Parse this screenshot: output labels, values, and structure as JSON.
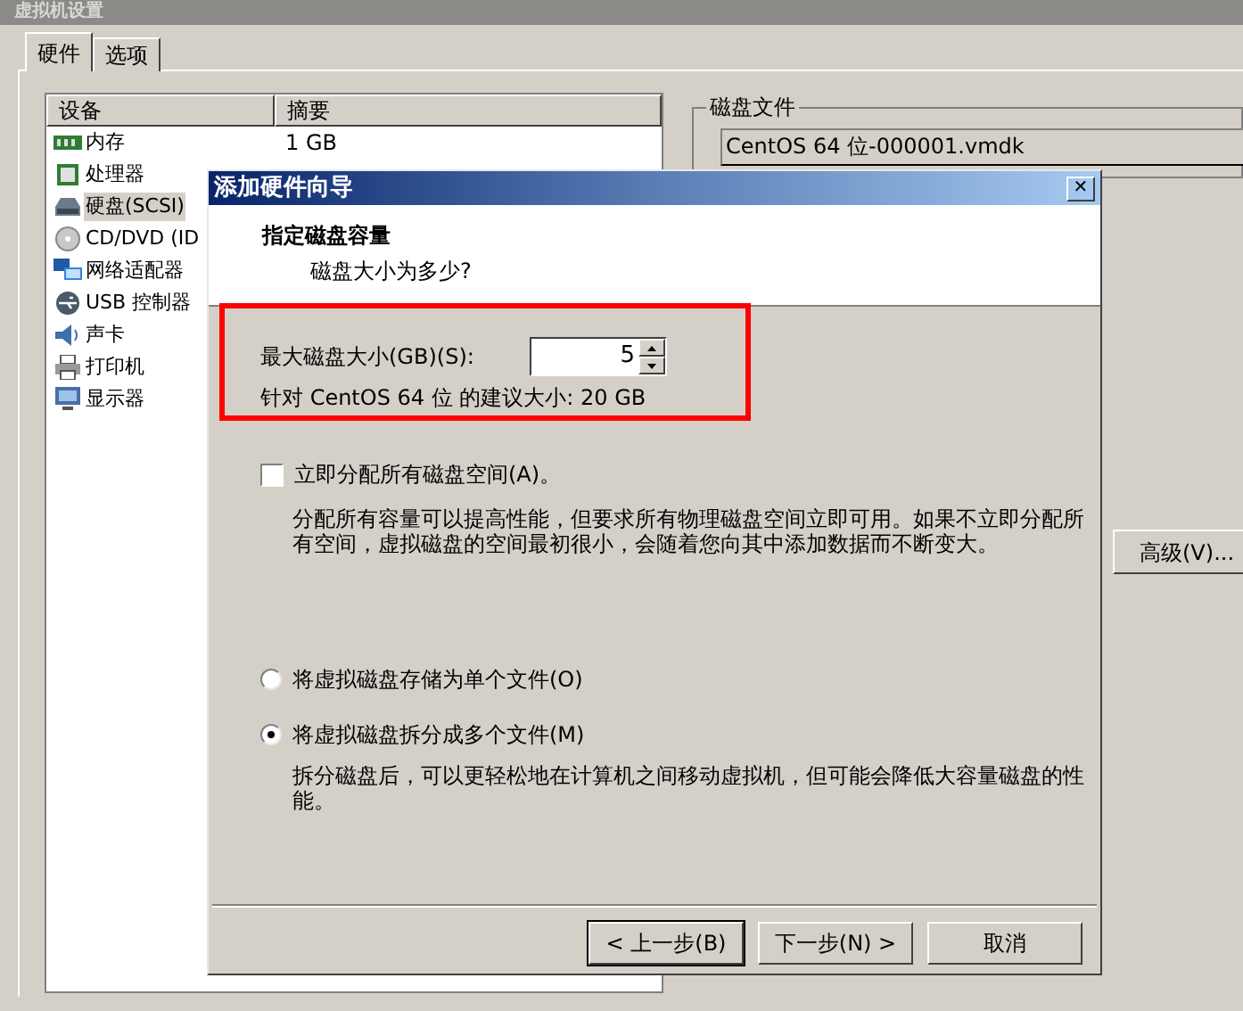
{
  "window": {
    "title": "虚拟机设置"
  },
  "tabs": [
    {
      "label": "硬件",
      "selected": true
    },
    {
      "label": "选项",
      "selected": false
    }
  ],
  "device_table": {
    "columns": [
      "设备",
      "摘要"
    ],
    "rows": [
      {
        "kind": "memory",
        "device": "内存",
        "summary": "1 GB",
        "selected": false
      },
      {
        "kind": "cpu",
        "device": "处理器",
        "selected": false
      },
      {
        "kind": "disk",
        "device": "硬盘(SCSI)",
        "selected": true
      },
      {
        "kind": "cdrom",
        "device": "CD/DVD (ID",
        "selected": false
      },
      {
        "kind": "network",
        "device": "网络适配器",
        "selected": false
      },
      {
        "kind": "usb",
        "device": "USB 控制器",
        "selected": false
      },
      {
        "kind": "sound",
        "device": "声卡",
        "selected": false
      },
      {
        "kind": "printer",
        "device": "打印机",
        "selected": false
      },
      {
        "kind": "display",
        "device": "显示器",
        "selected": false
      }
    ]
  },
  "disk_file": {
    "label": "磁盘文件",
    "value": "CentOS 64 位-000001.vmdk"
  },
  "advanced_button": "高级(V)...",
  "dialog": {
    "title": "添加硬件向导",
    "close": "✕",
    "heading": "指定磁盘容量",
    "subheading": "磁盘大小为多少?",
    "size_label": "最大磁盘大小(GB)(S):",
    "size_value": "5",
    "recommendation": "针对 CentOS 64 位 的建议大小: 20 GB",
    "allocate": {
      "label": "立即分配所有磁盘空间(A)。",
      "checked": false,
      "description": "分配所有容量可以提高性能，但要求所有物理磁盘空间立即可用。如果不立即分配所有空间，虚拟磁盘的空间最初很小，会随着您向其中添加数据而不断变大。"
    },
    "storage_options": [
      {
        "label": "将虚拟磁盘存储为单个文件(O)",
        "selected": false
      },
      {
        "label": "将虚拟磁盘拆分成多个文件(M)",
        "selected": true,
        "description": "拆分磁盘后，可以更轻松地在计算机之间移动虚拟机，但可能会降低大容量磁盘的性能。"
      }
    ],
    "buttons": [
      "< 上一步(B)",
      "下一步(N) >",
      "取消"
    ]
  }
}
